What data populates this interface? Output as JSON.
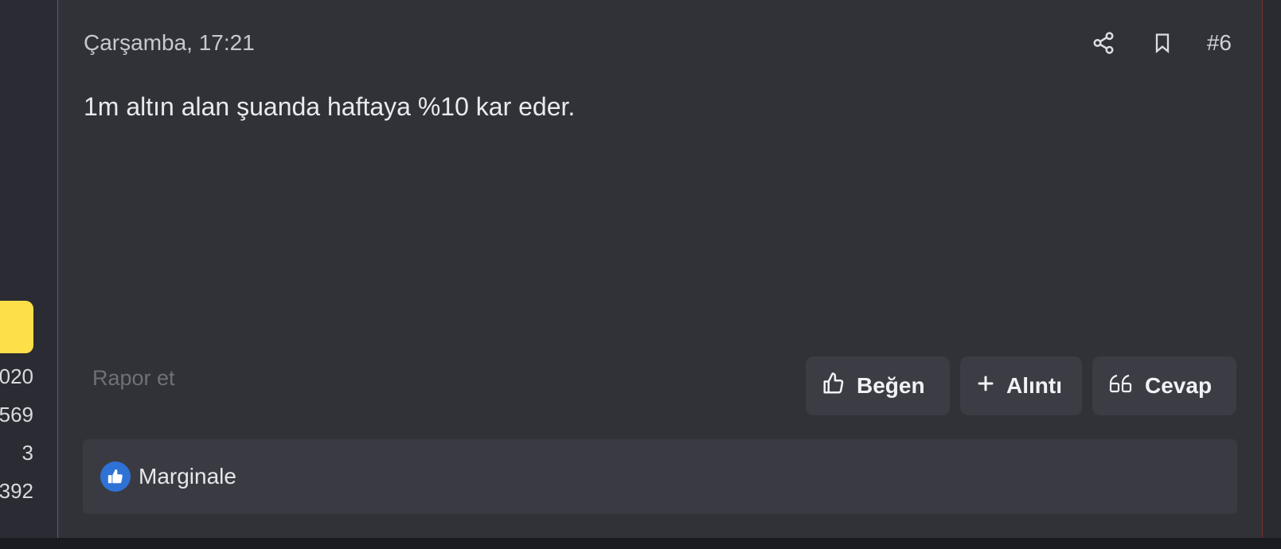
{
  "sidebar": {
    "stats": [
      "020",
      "569",
      "3",
      "392"
    ]
  },
  "post": {
    "date": "Çarşamba, 17:21",
    "number": "#6",
    "text": "1m altın alan şuanda haftaya %10 kar eder.",
    "report_label": "Rapor et",
    "actions": {
      "like_label": "Beğen",
      "quote_label": "Alıntı",
      "reply_label": "Cevap"
    },
    "reactions": {
      "users": [
        "Marginale"
      ]
    }
  },
  "icons": {
    "share": "share-icon",
    "bookmark": "bookmark-icon",
    "like": "thumbs-up-icon",
    "quote": "plus-icon",
    "reply": "quote-marks-icon",
    "reaction": "thumbs-up-badge-icon"
  },
  "colors": {
    "accent_yellow": "#fddf4a",
    "reaction_blue": "#2f72d6"
  }
}
